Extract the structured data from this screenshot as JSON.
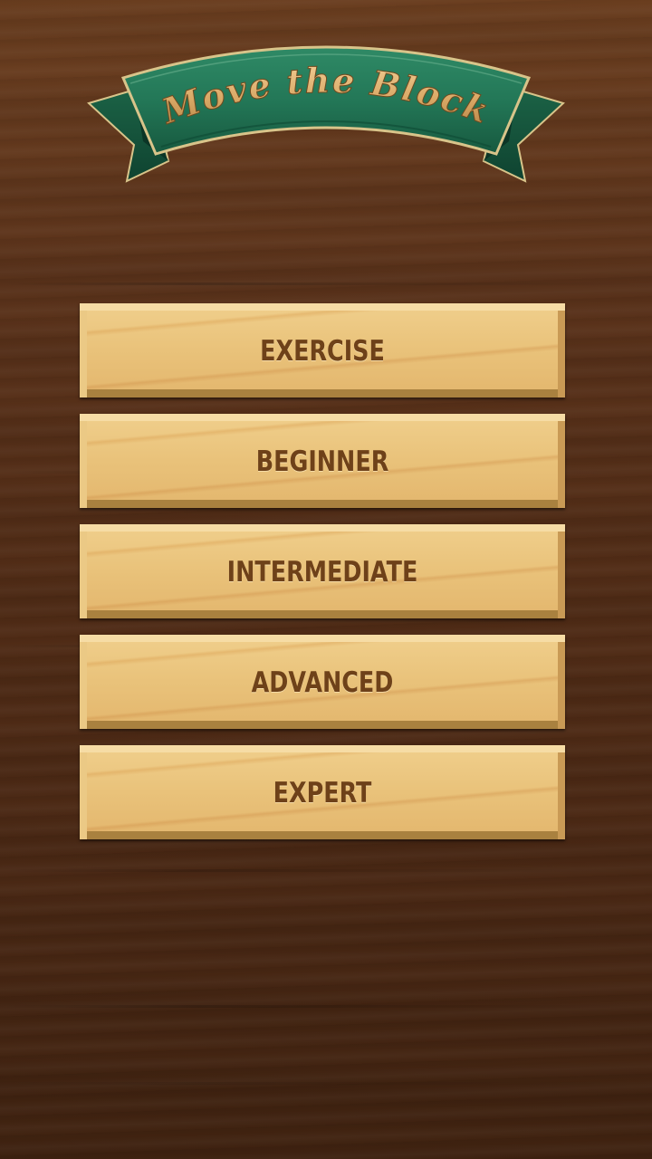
{
  "title": "Move the Block",
  "menu": {
    "items": [
      {
        "label": "EXERCISE"
      },
      {
        "label": "BEGINNER"
      },
      {
        "label": "INTERMEDIATE"
      },
      {
        "label": "ADVANCED"
      },
      {
        "label": "EXPERT"
      }
    ]
  },
  "colors": {
    "background": "#5a321a",
    "banner_green": "#1d6b4d",
    "button_wood": "#e9c27a",
    "button_text": "#6e4119",
    "title_gold": "#d9a865"
  }
}
